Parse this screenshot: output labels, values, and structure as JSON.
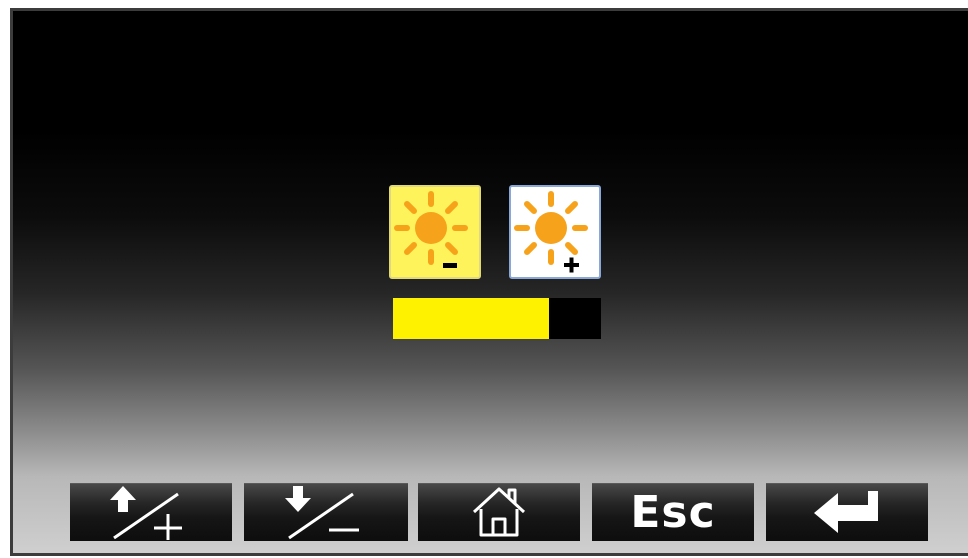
{
  "brightness": {
    "decrease_icon": "sun-minus-icon",
    "increase_icon": "sun-plus-icon",
    "level_fraction": 0.75,
    "bar_color": "#fff200",
    "track_color": "#000000"
  },
  "toolbar": {
    "buttons": [
      {
        "icon": "arrow-up-plus-icon"
      },
      {
        "icon": "arrow-down-minus-icon"
      },
      {
        "icon": "home-icon"
      },
      {
        "label": "Esc"
      },
      {
        "icon": "enter-icon"
      }
    ]
  },
  "colors": {
    "sun": "#f7a21b",
    "highlight": "#fff35c"
  }
}
